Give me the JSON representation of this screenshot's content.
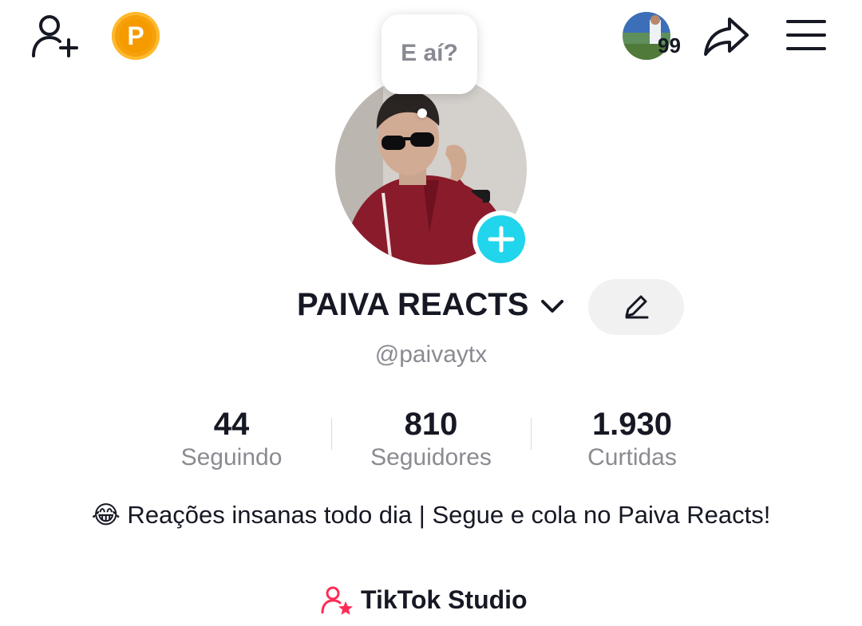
{
  "profile": {
    "display_name": "PAIVA REACTS",
    "username": "@paivaytx",
    "note_bubble": "E aí?",
    "bio": "😂 Reações insanas todo dia | Segue e cola no Paiva Reacts!"
  },
  "stats": [
    {
      "value": "44",
      "label": "Seguindo"
    },
    {
      "value": "810",
      "label": "Seguidores"
    },
    {
      "value": "1.930",
      "label": "Curtidas"
    }
  ],
  "top_bar": {
    "coin_letter": "P",
    "notification_count": "99"
  },
  "studio": {
    "label": "TikTok Studio"
  },
  "colors": {
    "accent_cyan": "#20d5ec",
    "studio_pink": "#fe2c55",
    "coin_orange": "#f59b00"
  }
}
